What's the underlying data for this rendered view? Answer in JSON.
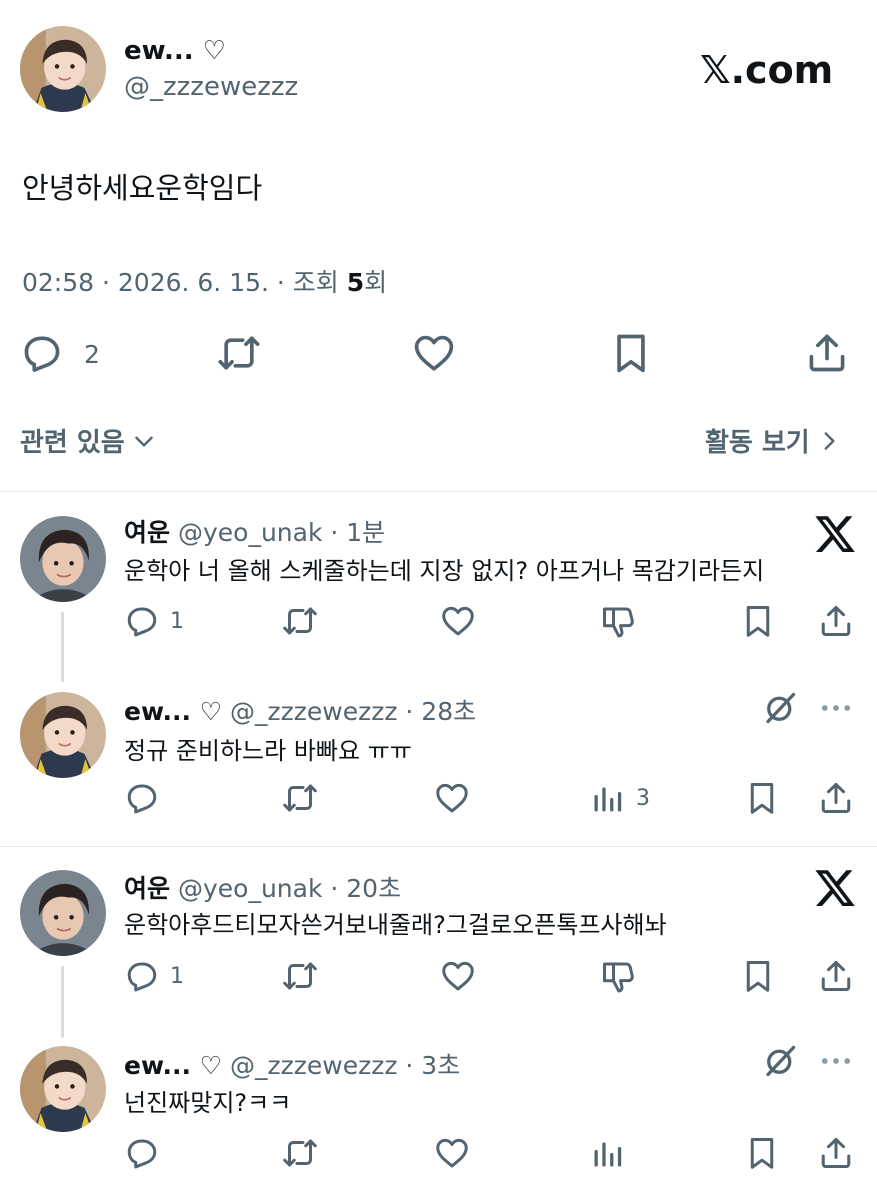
{
  "main_post": {
    "author_name": "ew... ♡",
    "handle": "@_zzzewezzz",
    "brand": "𝕏.com",
    "text": "안녕하세요운학임다",
    "meta_prefix": "02:58 · 2026. 6. 15. · 조회 ",
    "views": "5",
    "views_suffix": "회",
    "reply_count": "2"
  },
  "related": {
    "label": "관련 있음",
    "activity": "활동 보기"
  },
  "replies": [
    {
      "name": "여운",
      "handle_time": "@yeo_unak · 1분",
      "text": "운학아 너 올해 스케줄하는데 지장 없지? 아프거나 목감기라든지",
      "reply_count": "1"
    },
    {
      "name": "ew... ♡",
      "handle_time": "@_zzzewezzz · 28초",
      "text": "정규 준비하느라 바빠요 ㅠㅠ",
      "views": "3"
    },
    {
      "name": "여운",
      "handle_time": "@yeo_unak · 20초",
      "text": "운학아후드티모자쓴거보내줄래?그걸로오픈톡프사해놔",
      "reply_count": "1"
    },
    {
      "name": "ew... ♡",
      "handle_time": "@_zzzewezzz · 3초",
      "text": "넌진짜맞지?ㅋㅋ"
    }
  ],
  "icons": {
    "reply": "reply-icon",
    "retweet": "retweet-icon",
    "like": "heart-icon",
    "bookmark": "bookmark-icon",
    "share": "share-icon",
    "dislike": "thumbs-down-icon",
    "views": "analytics-icon",
    "more": "more-icon",
    "grok": "grok-icon",
    "x_logo": "x-logo-icon"
  },
  "colors": {
    "text": "#0f1419",
    "muted": "#536471",
    "divider": "#e6e9eb"
  }
}
